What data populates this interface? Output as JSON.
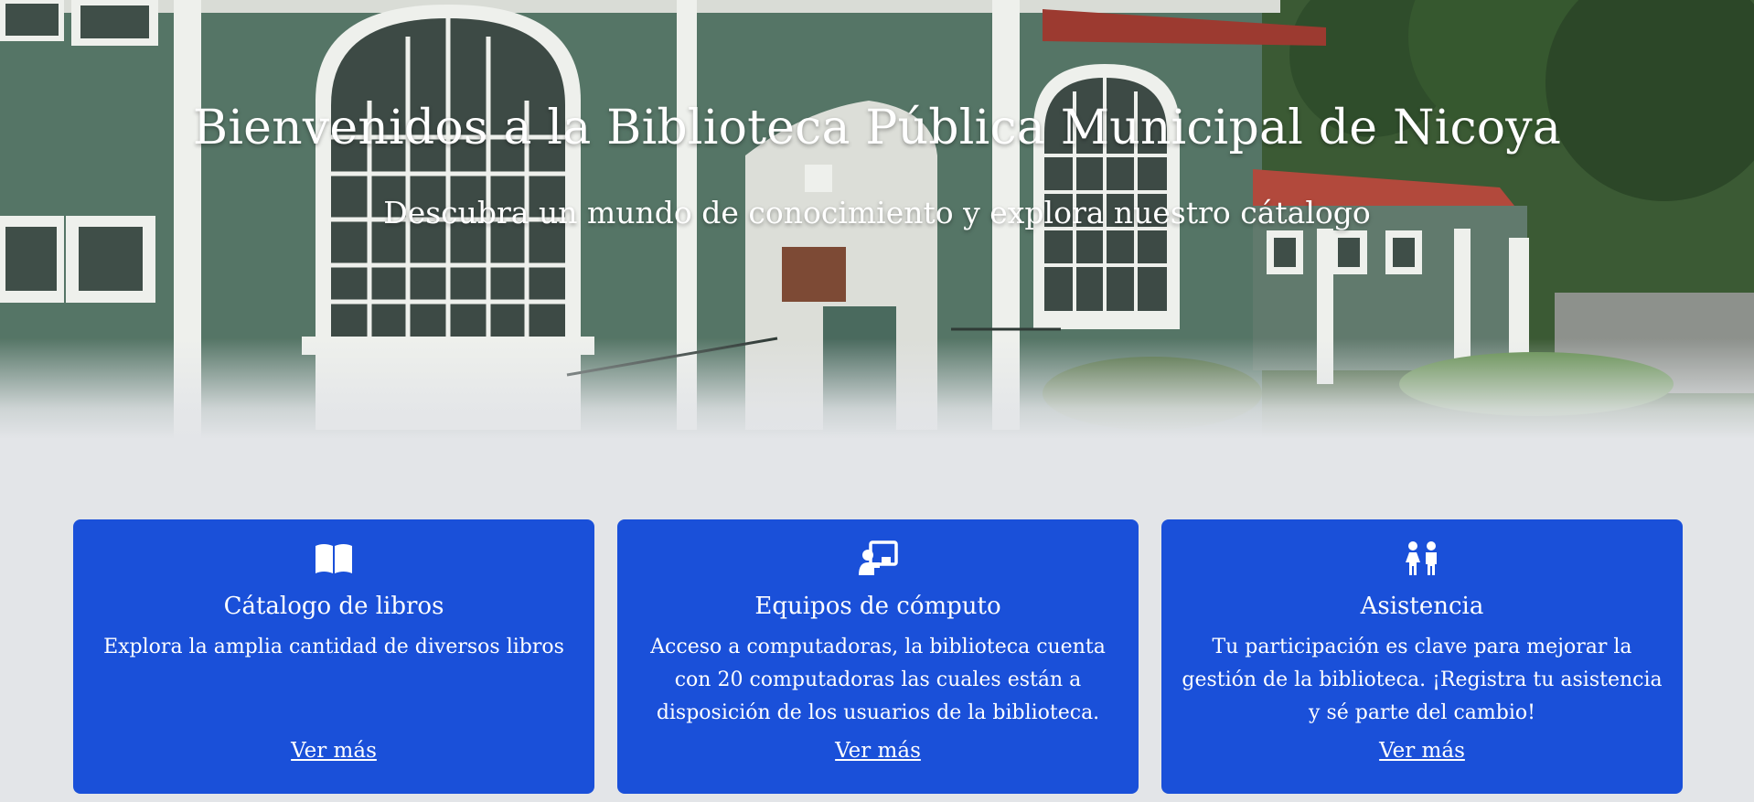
{
  "hero": {
    "title": "Bienvenidos a la Biblioteca Pública Municipal de Nicoya",
    "subtitle": "Descubra un mundo de conocimiento y explora nuestro cátalogo"
  },
  "cards": [
    {
      "icon": "book-open-icon",
      "title": "Cátalogo de libros",
      "text": "Explora la amplia cantidad de diversos libros",
      "link": "Ver más"
    },
    {
      "icon": "chalkboard-teacher-icon",
      "title": "Equipos de cómputo",
      "text": "Acceso a computadoras, la biblioteca cuenta con 20 computadoras las cuales están a disposición de los usuarios de la biblioteca.",
      "link": "Ver más"
    },
    {
      "icon": "children-icon",
      "title": "Asistencia",
      "text": "Tu participación es clave para mejorar la gestión de la biblioteca. ¡Registra tu asistencia y sé parte del cambio!",
      "link": "Ver más"
    }
  ],
  "colors": {
    "card_bg": "#1a50d9",
    "page_bg": "#e3e5e8",
    "text": "#ffffff"
  }
}
